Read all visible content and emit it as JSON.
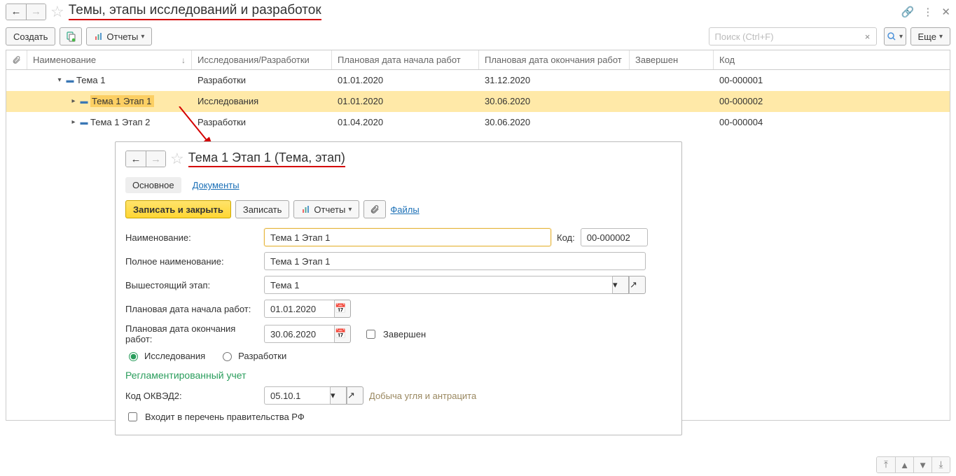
{
  "page": {
    "title": "Темы, этапы исследований и разработок"
  },
  "toolbar": {
    "create": "Создать",
    "reports": "Отчеты",
    "search_placeholder": "Поиск (Ctrl+F)",
    "more": "Еще"
  },
  "grid": {
    "columns": {
      "name": "Наименование",
      "type": "Исследования/Разработки",
      "date_start": "Плановая дата начала работ",
      "date_end": "Плановая дата окончания работ",
      "done": "Завершен",
      "code": "Код"
    },
    "rows": [
      {
        "indent": 0,
        "caret": "▾",
        "name": "Тема 1",
        "type": "Разработки",
        "date_start": "01.01.2020",
        "date_end": "31.12.2020",
        "code": "00-000001",
        "selected": false
      },
      {
        "indent": 1,
        "caret": "▸",
        "name": "Тема 1 Этап 1",
        "type": "Исследования",
        "date_start": "01.01.2020",
        "date_end": "30.06.2020",
        "code": "00-000002",
        "selected": true
      },
      {
        "indent": 1,
        "caret": "▸",
        "name": "Тема 1 Этап 2",
        "type": "Разработки",
        "date_start": "01.04.2020",
        "date_end": "30.06.2020",
        "code": "00-000004",
        "selected": false
      }
    ]
  },
  "card": {
    "title": "Тема 1 Этап 1 (Тема, этап)",
    "tabs": {
      "main": "Основное",
      "docs": "Документы"
    },
    "toolbar": {
      "save_close": "Записать и закрыть",
      "save": "Записать",
      "reports": "Отчеты",
      "files": "Файлы"
    },
    "fields": {
      "name_label": "Наименование:",
      "name_value": "Тема 1 Этап 1",
      "code_label": "Код:",
      "code_value": "00-000002",
      "full_name_label": "Полное наименование:",
      "full_name_value": "Тема 1 Этап 1",
      "parent_label": "Вышестоящий этап:",
      "parent_value": "Тема 1",
      "date_start_label": "Плановая дата начала работ:",
      "date_start_value": "01.01.2020",
      "date_end_label": "Плановая дата окончания работ:",
      "date_end_value": "30.06.2020",
      "done_label": "Завершен",
      "radio_research": "Исследования",
      "radio_dev": "Разработки",
      "section": "Регламентированный учет",
      "okved_label": "Код ОКВЭД2:",
      "okved_value": "05.10.1",
      "okved_desc": "Добыча угля и антрацита",
      "gov_list": "Входит в перечень правительства РФ"
    }
  }
}
